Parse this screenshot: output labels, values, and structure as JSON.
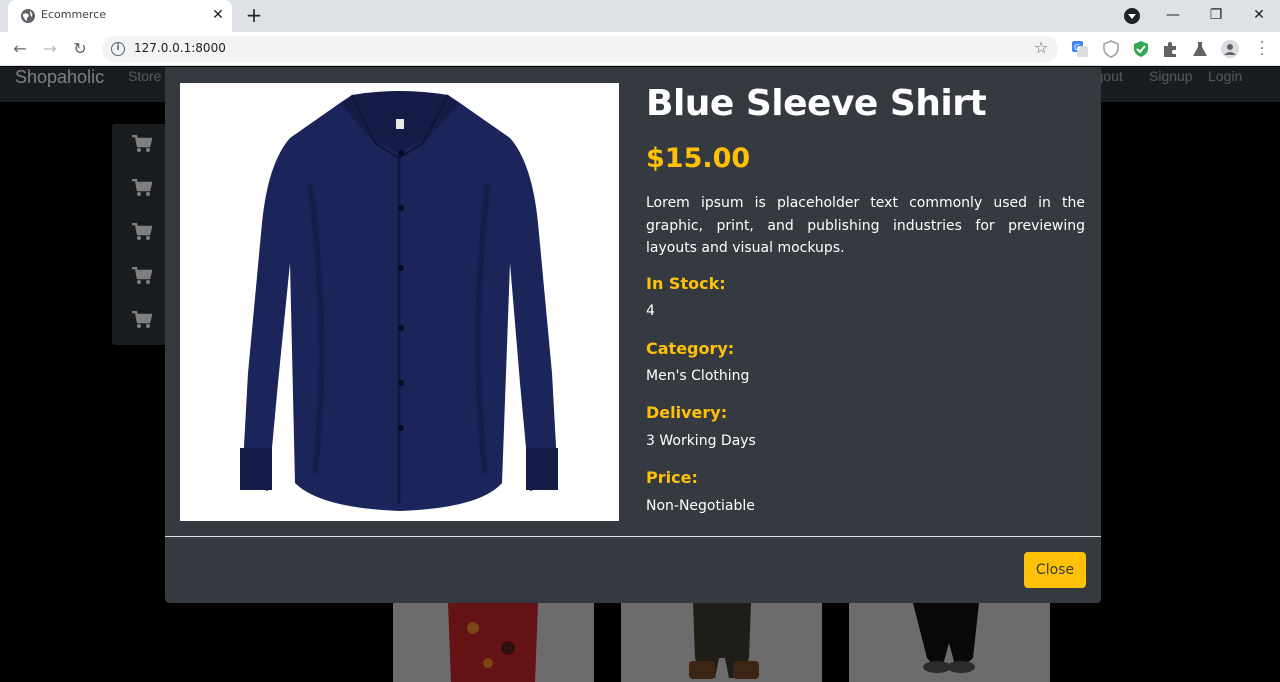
{
  "browser": {
    "tab_title": "Ecommerce",
    "url": "127.0.0.1:8000",
    "new_tab_symbol": "+",
    "tab_close_symbol": "✕",
    "window_controls": [
      "—",
      "❐",
      "✕"
    ]
  },
  "navbar": {
    "brand": "Shopaholic",
    "left_links": [
      "Store"
    ],
    "right_links": [
      "Logout",
      "Signup",
      "Login"
    ]
  },
  "sidebar": {
    "icons": [
      "cart-icon",
      "cart-icon",
      "cart-icon",
      "cart-icon",
      "cart-icon"
    ]
  },
  "modal": {
    "title": "Blue Sleeve Shirt",
    "price": "$15.00",
    "description": "Lorem ipsum is placeholder text commonly used in the graphic, print, and publishing industries for previewing layouts and visual mockups.",
    "attributes": [
      {
        "label": "In Stock:",
        "value": "4"
      },
      {
        "label": "Category:",
        "value": "Men's Clothing"
      },
      {
        "label": "Delivery:",
        "value": "3 Working Days"
      },
      {
        "label": "Price:",
        "value": "Non-Negotiable"
      }
    ],
    "close_label": "Close"
  },
  "colors": {
    "accent": "#ffc107",
    "modal_bg": "#343a40",
    "shirt": "#1b2559"
  }
}
